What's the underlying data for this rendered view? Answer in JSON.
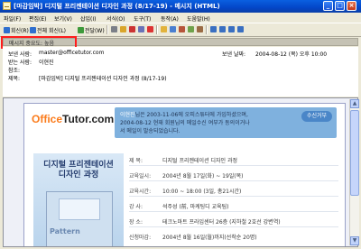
{
  "window": {
    "title": "[마감임박] 디지털 프리젠테이션 디자인 과정 (8/17-19) - 메시지 (HTML)",
    "controls": {
      "minimize": "_",
      "maximize": "□",
      "close": "×"
    }
  },
  "menu": [
    "파일(F)",
    "편집(E)",
    "보기(V)",
    "삽입(I)",
    "서식(O)",
    "도구(T)",
    "동작(A)",
    "도움말(H)"
  ],
  "toolbar": {
    "reply": "회신(R)",
    "reply_all": "전체 회신(L)",
    "forward": "전달(W)"
  },
  "importance": {
    "text": "메시지 중요도: 높음"
  },
  "header": {
    "from_label": "보낸 사람:",
    "from_value": "master@officetutor.com",
    "to_label": "받는 사람:",
    "to_value": "이현진",
    "cc_label": "참조:",
    "cc_value": "",
    "subject_label": "제목:",
    "subject_value": "[마감임박] 디지털 프리젠테이션 디자인 과정 (8/17-19)",
    "sent_label": "보낸 날짜:",
    "sent_value": "2004-08-12 (목) 오후 10:00"
  },
  "email": {
    "logo_part1": "Office",
    "logo_part2": "Tutor.com",
    "promo_line1_highlight": "이현진",
    "promo_line1_rest": "님은 2003-11-06에 오피스튜터에 가입하셨으며,",
    "promo_line2": "2004-08-12 현재 회원님의 메일수신 여부가 동의이거나",
    "promo_line3": "서 메일이 발송되었습니다.",
    "signup_button": "수신거부",
    "book_title_line1": "디지털 프리젠테이션",
    "book_title_line2": "디자인 과정",
    "book_cover_text": "Pattern",
    "details": [
      {
        "label": "제 목:",
        "value": "디지털 프리젠테이션 디자인 과정"
      },
      {
        "label": "교육일시:",
        "value": "2004년 8월 17일(화) ~ 19일(목)"
      },
      {
        "label": "교육시간:",
        "value": "10:00 ~ 18:00 (3일, 총21시간)"
      },
      {
        "label": "강 사:",
        "value": "석주성 (前, 마케팅디 교육팀)"
      },
      {
        "label": "장 소:",
        "value": "테크노마트 프라임센터 26층 (지하철 2호선 강변역)"
      },
      {
        "label": "신청마감:",
        "value": "2004년 8월 16일(월)까지(선착순 20명)"
      }
    ]
  }
}
